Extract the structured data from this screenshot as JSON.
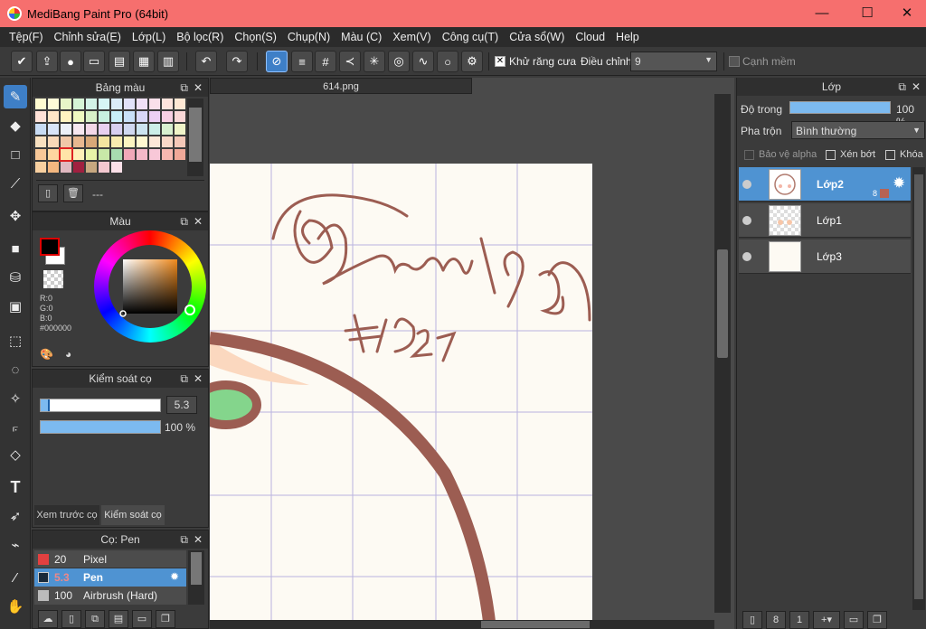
{
  "window": {
    "title": "MediBang Paint Pro (64bit)",
    "minimize": "—",
    "maximize": "☐",
    "close": "✕"
  },
  "menu": [
    "Tệp(F)",
    "Chỉnh sửa(E)",
    "Lớp(L)",
    "Bộ lọc(R)",
    "Chọn(S)",
    "Chụp(N)",
    "Màu (C)",
    "Xem(V)",
    "Công cụ(T)",
    "Cửa sổ(W)",
    "Cloud",
    "Help"
  ],
  "toolbar": {
    "antialias_label": "Khử răng cưa",
    "antialias_checked": "✕",
    "correction_label": "Điều chỉnh",
    "correction_value": "9",
    "soft_edge_label": "Cạnh mềm"
  },
  "palette_panel": {
    "title": "Bảng màu",
    "footer_text": "---"
  },
  "color_panel": {
    "title": "Màu",
    "r": "R:0",
    "g": "G:0",
    "b": "B:0",
    "hex": "#000000"
  },
  "brush_control": {
    "title": "Kiểm soát cọ",
    "size_value": "5.3",
    "opacity_value": "100 %",
    "tab_preview": "Xem trước cọ",
    "tab_control": "Kiểm soát cọ"
  },
  "brush_list": {
    "title": "Cọ: Pen",
    "items": [
      {
        "size": "20",
        "name": "Pixel",
        "color": "#e34040"
      },
      {
        "size": "5.3",
        "name": "Pen",
        "color": "#1a2a3a"
      },
      {
        "size": "100",
        "name": "Airbrush (Hard)",
        "color": "#bbbbbb"
      }
    ]
  },
  "document": {
    "tab_name": "614.png"
  },
  "layer_panel": {
    "title": "Lớp",
    "opacity_label": "Độ trong",
    "opacity_value": "100 %",
    "blend_label": "Pha trộn",
    "blend_value": "Bình thường",
    "protect_alpha": "Bảo vệ alpha",
    "clipping": "Xén bớt",
    "lock": "Khóa",
    "layers": [
      {
        "name": "Lớp2",
        "badge": "8"
      },
      {
        "name": "Lớp1"
      },
      {
        "name": "Lớp3"
      }
    ]
  },
  "colors": {
    "accent": "#4f93d2",
    "titlebar": "#f66f6e",
    "stroke": "#9c5d52"
  }
}
